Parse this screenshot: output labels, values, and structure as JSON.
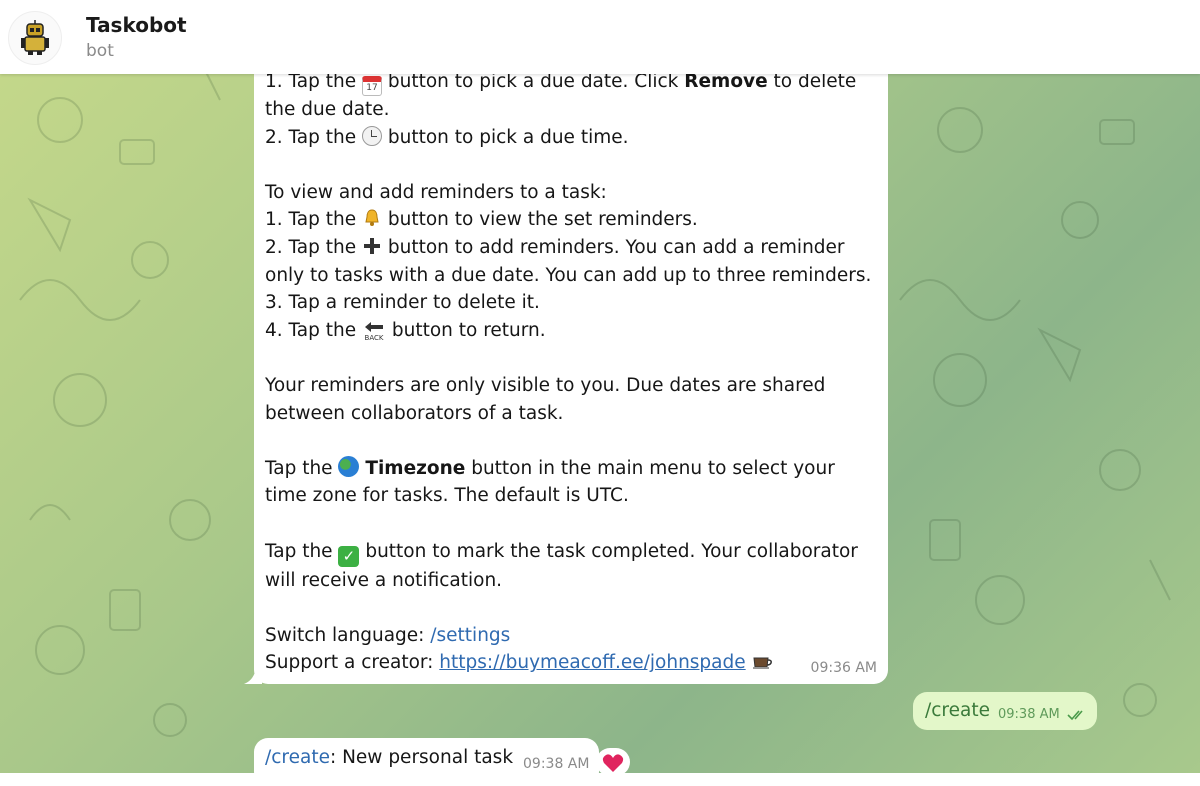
{
  "header": {
    "title": "Taskobot",
    "subtitle": "bot"
  },
  "message1": {
    "line1_pre": "1. Tap the ",
    "line1_mid": " button to pick a due date. Click ",
    "line1_bold": "Remove",
    "line1_post": " to delete the due date.",
    "line2_pre": "2. Tap the ",
    "line2_post": " button to pick a due time.",
    "reminders_intro": "To view and add reminders to a task:",
    "r1_pre": "1. Tap the ",
    "r1_post": " button to view the set reminders.",
    "r2_pre": "2. Tap the ",
    "r2_post": " button to add reminders. You can add a reminder only to tasks with a due date. You can add up to three reminders.",
    "r3": "3. Tap a reminder to delete it.",
    "r4_pre": "4. Tap the ",
    "r4_post": " button to return.",
    "visibility": "Your reminders are only visible to you. Due dates are shared between collaborators of a task.",
    "tz_pre": "Tap the ",
    "tz_bold": "Timezone",
    "tz_post": " button in the main menu to select your time zone for tasks. The default is UTC.",
    "done_pre": "Tap the ",
    "done_post": " button to mark the task completed. Your collaborator will receive a notification.",
    "switch_label": "Switch language: ",
    "switch_cmd": "/settings",
    "support_label": "Support a creator: ",
    "support_link": "https://buymeacoff.ee/johnspade",
    "calendar_day": "17",
    "back_label": "BACK",
    "time": "09:36 AM"
  },
  "message2": {
    "text": "/create",
    "time": "09:38 AM"
  },
  "message3": {
    "cmd": "/create",
    "text": ": New personal task",
    "time": "09:38 AM",
    "reaction": "heart"
  },
  "icons": {
    "calendar": "calendar-icon",
    "clock": "clock-icon",
    "bell": "bell-icon",
    "plus": "plus-icon",
    "back": "back-icon",
    "globe": "globe-icon",
    "check": "check-mark-icon",
    "coffee": "coffee-icon",
    "read": "double-check-icon"
  },
  "colors": {
    "link": "#2f6ab0",
    "outgoing_bubble": "#e3f7c9",
    "incoming_bubble": "#ffffff",
    "header": "#ffffff"
  }
}
